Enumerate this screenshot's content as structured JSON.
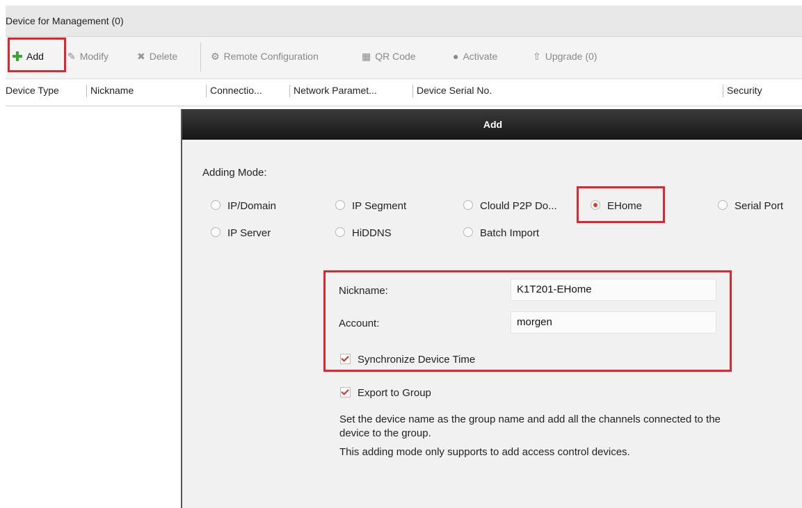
{
  "title": "Device for Management (0)",
  "toolbar": {
    "add": "Add",
    "modify": "Modify",
    "delete": "Delete",
    "remote_config": "Remote Configuration",
    "qr_code": "QR Code",
    "activate": "Activate",
    "upgrade": "Upgrade (0)"
  },
  "columns": {
    "device_type": "Device Type",
    "nickname": "Nickname",
    "connection": "Connectio...",
    "network": "Network Paramet...",
    "serial": "Device Serial No.",
    "security": "Security"
  },
  "dialog": {
    "title": "Add",
    "adding_mode_label": "Adding Mode:",
    "modes": {
      "ip_domain": "IP/Domain",
      "ip_segment": "IP Segment",
      "cloud_p2p": "Clould P2P Do...",
      "ehome": "EHome",
      "serial_port": "Serial Port",
      "ip_server": "IP Server",
      "hiddns": "HiDDNS",
      "batch_import": "Batch Import"
    },
    "selected_mode": "EHome",
    "nickname_label": "Nickname:",
    "nickname_value": "K1T201-EHome",
    "account_label": "Account:",
    "account_value": "morgen",
    "sync_time_label": "Synchronize Device Time",
    "export_group_label": "Export to Group",
    "export_desc": "Set the device name as the group name and add all the channels connected to the device to the group.",
    "mode_note": "This adding mode only supports to add access control devices."
  }
}
